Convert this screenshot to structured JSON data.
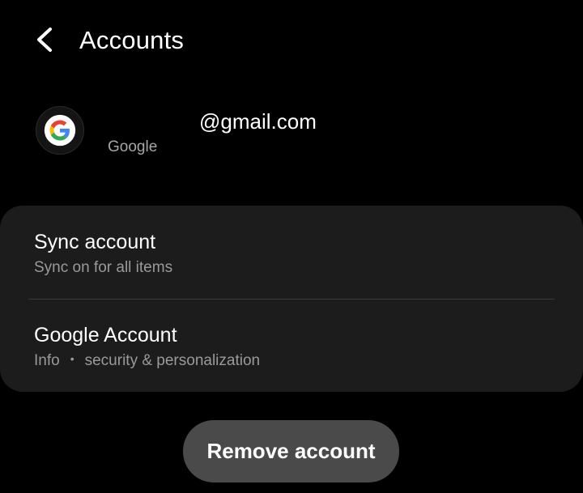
{
  "header": {
    "title": "Accounts",
    "back_icon": "chevron-left-icon"
  },
  "account": {
    "icon": "google-g-logo",
    "email_visible": "@gmail.com",
    "type": "Google"
  },
  "settings": {
    "items": [
      {
        "title": "Sync account",
        "subtitle": "Sync on for all items"
      },
      {
        "title": "Google Account",
        "subtitle_parts": [
          "Info",
          "security & personalization"
        ],
        "separator": "•"
      }
    ]
  },
  "actions": {
    "remove_label": "Remove account"
  },
  "colors": {
    "background": "#000000",
    "card": "#1c1c1c",
    "button": "#4a4a4a",
    "primary_text": "#ffffff",
    "secondary_text": "#9a9a9a",
    "google_blue": "#4285F4",
    "google_red": "#EA4335",
    "google_yellow": "#FBBC05",
    "google_green": "#34A853"
  }
}
